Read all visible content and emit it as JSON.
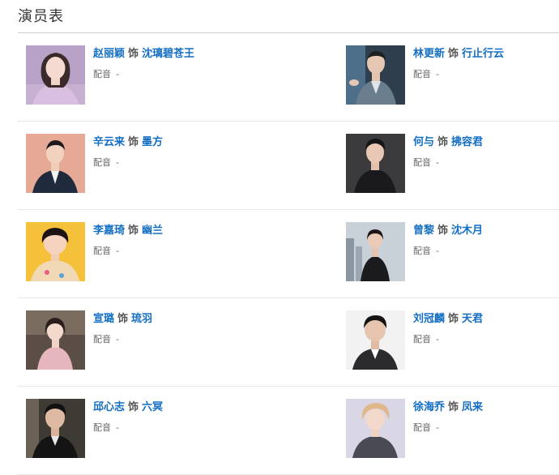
{
  "section": {
    "title": "演员表"
  },
  "labels": {
    "as": "饰",
    "dub": "配音",
    "dub_empty": "-"
  },
  "colors": {
    "link": "#136ec2",
    "divider": "#e8e8e8",
    "title_rule": "#cfcfcf"
  },
  "cast": [
    {
      "actor": "赵丽颖",
      "role": "沈璃碧苍王",
      "dub": "配音",
      "dub_value": "-",
      "photo_icon": "actor-photo"
    },
    {
      "actor": "林更新",
      "role": "行止行云",
      "dub": "配音",
      "dub_value": "-",
      "photo_icon": "actor-photo"
    },
    {
      "actor": "辛云来",
      "role": "墨方",
      "dub": "配音",
      "dub_value": "-",
      "photo_icon": "actor-photo"
    },
    {
      "actor": "何与",
      "role": "拂容君",
      "dub": "配音",
      "dub_value": "-",
      "photo_icon": "actor-photo"
    },
    {
      "actor": "李嘉琦",
      "role": "幽兰",
      "dub": "配音",
      "dub_value": "-",
      "photo_icon": "actor-photo"
    },
    {
      "actor": "曾黎",
      "role": "沈木月",
      "dub": "配音",
      "dub_value": "-",
      "photo_icon": "actor-photo"
    },
    {
      "actor": "宣璐",
      "role": "琉羽",
      "dub": "配音",
      "dub_value": "-",
      "photo_icon": "actor-photo"
    },
    {
      "actor": "刘冠麟",
      "role": "天君",
      "dub": "配音",
      "dub_value": "-",
      "photo_icon": "actor-photo"
    },
    {
      "actor": "邱心志",
      "role": "六冥",
      "dub": "配音",
      "dub_value": "-",
      "photo_icon": "actor-photo"
    },
    {
      "actor": "徐海乔",
      "role": "凤来",
      "dub": "配音",
      "dub_value": "-",
      "photo_icon": "actor-photo"
    }
  ]
}
